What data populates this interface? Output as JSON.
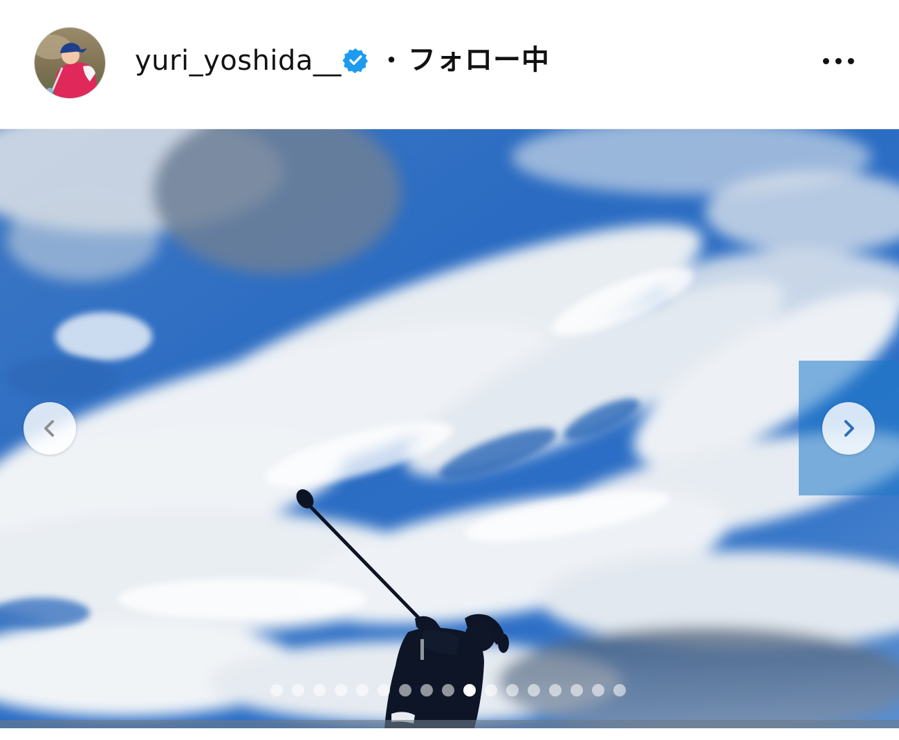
{
  "header": {
    "username": "yuri_yoshida__",
    "separator": "・",
    "follow_status": "フォロー中",
    "more_icon": "more-horizontal-icon",
    "verified_icon": "verified-badge-icon"
  },
  "colors": {
    "verified_blue": "#1d9bf0",
    "text": "#111111",
    "sky_deep": "#1f63b8",
    "sky_light": "#4f8fd8"
  },
  "carousel": {
    "prev_icon": "chevron-left-icon",
    "next_icon": "chevron-right-icon",
    "total_slides": 17,
    "current_slide": 10
  }
}
